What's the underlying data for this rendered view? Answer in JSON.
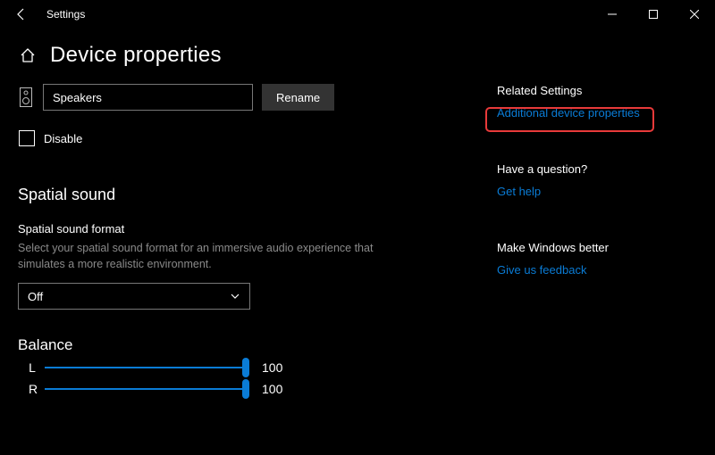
{
  "app": {
    "title": "Settings"
  },
  "page": {
    "title": "Device properties"
  },
  "device": {
    "name": "Speakers",
    "rename_label": "Rename",
    "disable_label": "Disable"
  },
  "spatial": {
    "section_title": "Spatial sound",
    "format_label": "Spatial sound format",
    "description": "Select your spatial sound format for an immersive audio experience that simulates a more realistic environment.",
    "selected": "Off"
  },
  "balance": {
    "title": "Balance",
    "left": {
      "label": "L",
      "value": "100"
    },
    "right": {
      "label": "R",
      "value": "100"
    }
  },
  "side": {
    "related_title": "Related Settings",
    "related_link": "Additional device properties",
    "question_title": "Have a question?",
    "question_link": "Get help",
    "feedback_title": "Make Windows better",
    "feedback_link": "Give us feedback"
  }
}
